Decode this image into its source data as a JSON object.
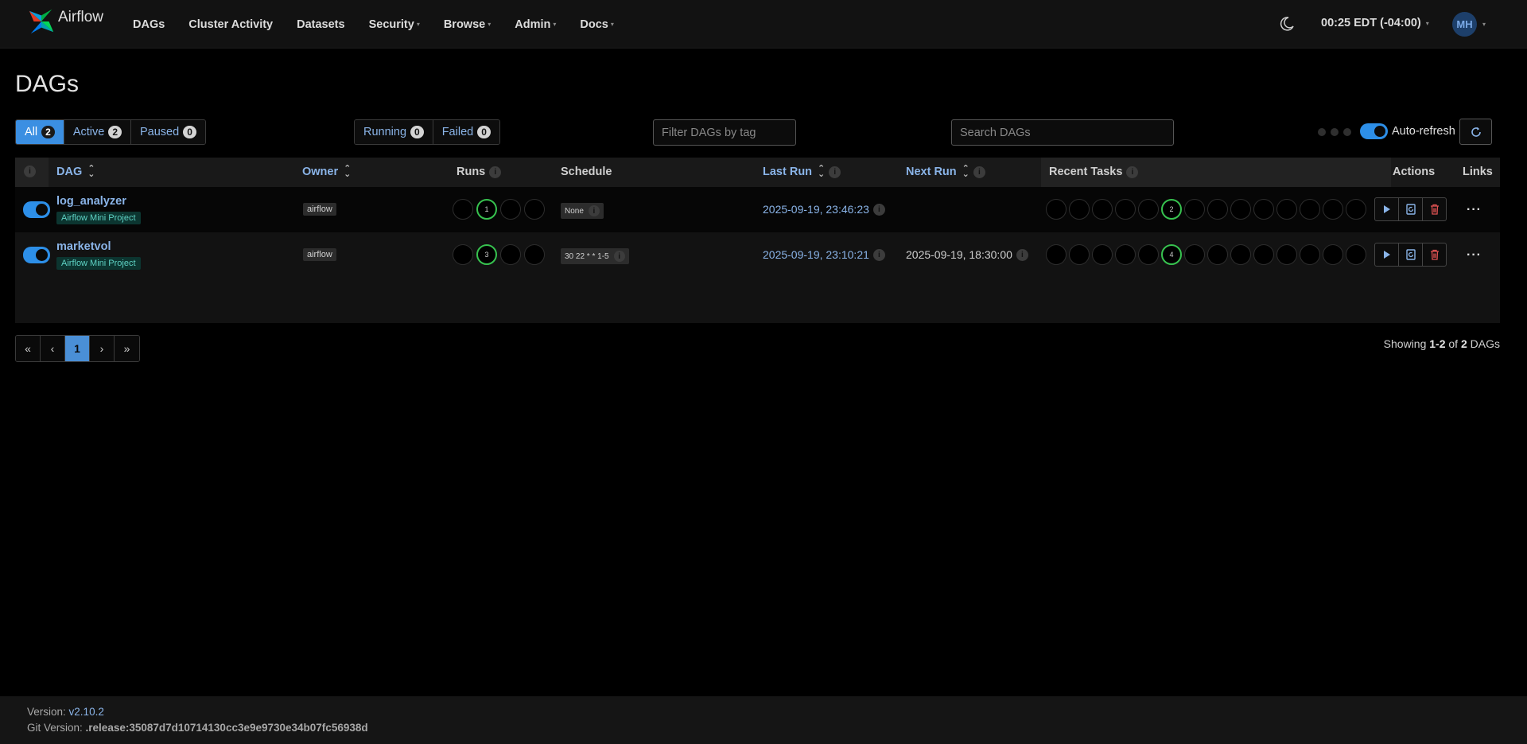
{
  "navbar": {
    "brand": "Airflow",
    "items": [
      {
        "label": "DAGs",
        "dropdown": false
      },
      {
        "label": "Cluster Activity",
        "dropdown": false
      },
      {
        "label": "Datasets",
        "dropdown": false
      },
      {
        "label": "Security",
        "dropdown": true
      },
      {
        "label": "Browse",
        "dropdown": true
      },
      {
        "label": "Admin",
        "dropdown": true
      },
      {
        "label": "Docs",
        "dropdown": true
      }
    ],
    "clock": "00:25 EDT (-04:00)",
    "user_initials": "MH"
  },
  "page_title": "DAGs",
  "status_filters": {
    "all": {
      "label": "All",
      "count": "2"
    },
    "active": {
      "label": "Active",
      "count": "2"
    },
    "paused": {
      "label": "Paused",
      "count": "0"
    }
  },
  "run_filters": {
    "running": {
      "label": "Running",
      "count": "0"
    },
    "failed": {
      "label": "Failed",
      "count": "0"
    }
  },
  "tag_filter": {
    "placeholder": "Filter DAGs by tag"
  },
  "search": {
    "placeholder": "Search DAGs"
  },
  "auto_refresh_label": "Auto-refresh",
  "table": {
    "headers": {
      "dag": "DAG",
      "owner": "Owner",
      "runs": "Runs",
      "schedule": "Schedule",
      "last_run": "Last Run",
      "next_run": "Next Run",
      "recent_tasks": "Recent Tasks",
      "actions": "Actions",
      "links": "Links"
    },
    "info_glyph": "i",
    "rows": [
      {
        "name": "log_analyzer",
        "tag": "Airflow Mini Project",
        "owner": "airflow",
        "runs": [
          "",
          "1",
          "",
          ""
        ],
        "schedule": "None",
        "last_run": "2025-09-19, 23:46:23",
        "next_run": "",
        "recent_tasks_success": "2"
      },
      {
        "name": "marketvol",
        "tag": "Airflow Mini Project",
        "owner": "airflow",
        "runs": [
          "",
          "3",
          "",
          ""
        ],
        "schedule": "30 22 * * 1-5",
        "last_run": "2025-09-19, 23:10:21",
        "next_run": "2025-09-19, 18:30:00",
        "recent_tasks_success": "4"
      }
    ]
  },
  "pagination": {
    "first": "«",
    "prev": "‹",
    "current": "1",
    "next": "›",
    "last": "»"
  },
  "showing": {
    "prefix": "Showing",
    "range": "1-2",
    "of": "of",
    "total": "2",
    "suffix": "DAGs"
  },
  "footer": {
    "version_label": "Version:",
    "version": "v2.10.2",
    "git_label": "Git Version:",
    "git_version": ".release:35087d7d10714130cc3e9e9730e34b07fc56938d"
  },
  "colors": {
    "accent": "#3b8fe2",
    "link": "#8ab4e8",
    "success": "#37c24f",
    "tag_bg": "#0c3530",
    "delete": "#e05252"
  }
}
